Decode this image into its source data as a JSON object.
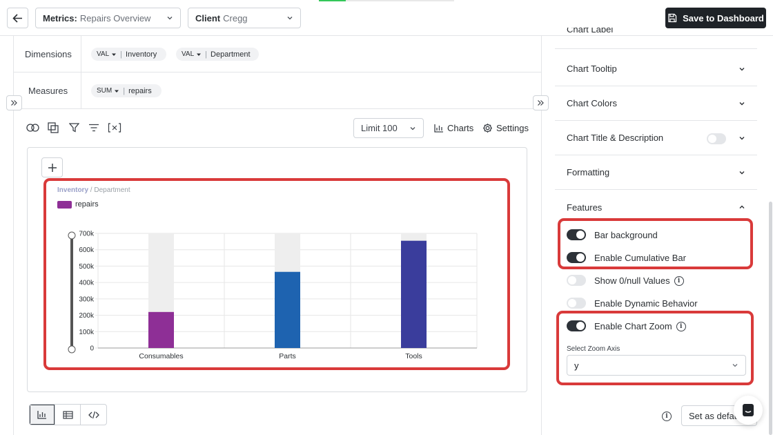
{
  "toolbar": {
    "metrics_label": "Metrics:",
    "metrics_value": "Repairs Overview",
    "client_label": "Client",
    "client_value": "Cregg",
    "save_label": "Save to Dashboard"
  },
  "query": {
    "dimensions_label": "Dimensions",
    "measures_label": "Measures",
    "dimensions": [
      {
        "agg": "VAL",
        "field": "Inventory"
      },
      {
        "agg": "VAL",
        "field": "Department"
      }
    ],
    "measures": [
      {
        "agg": "SUM",
        "field": "repairs"
      }
    ]
  },
  "chart_toolbar": {
    "limit_value": "Limit 100",
    "charts_label": "Charts",
    "settings_label": "Settings"
  },
  "chart_data": {
    "type": "bar",
    "breadcrumb_primary": "Inventory",
    "breadcrumb_separator": "/",
    "breadcrumb_secondary": "Department",
    "categories": [
      "Consumables",
      "Parts",
      "Tools"
    ],
    "series": [
      {
        "name": "repairs",
        "values": [
          220000,
          465000,
          655000
        ],
        "colors": [
          "#8e2f96",
          "#1e63b0",
          "#3a3d9c"
        ]
      }
    ],
    "background_color": "#eeeeee",
    "legend_color": "#8e2f96",
    "yticks": [
      "700k",
      "600k",
      "500k",
      "400k",
      "300k",
      "200k",
      "100k",
      "0"
    ],
    "ylim": [
      0,
      700000
    ],
    "grid": true,
    "legend_position": "top-left"
  },
  "panel": {
    "partial_label": "Chart Label",
    "sections": [
      {
        "label": "Chart Tooltip"
      },
      {
        "label": "Chart Colors"
      },
      {
        "label": "Chart Title & Description"
      },
      {
        "label": "Formatting"
      },
      {
        "label": "Features"
      }
    ],
    "features": [
      {
        "label": "Bar background",
        "on": true
      },
      {
        "label": "Enable Cumulative Bar",
        "on": true
      },
      {
        "label": "Show 0/null Values",
        "on": false
      },
      {
        "label": "Enable Dynamic Behavior",
        "on": false
      },
      {
        "label": "Enable Chart Zoom",
        "on": true
      }
    ],
    "zoom_axis_label": "Select Zoom Axis",
    "zoom_axis_value": "y",
    "set_default_label": "Set as default"
  },
  "ui": {
    "progress": 0.2
  }
}
